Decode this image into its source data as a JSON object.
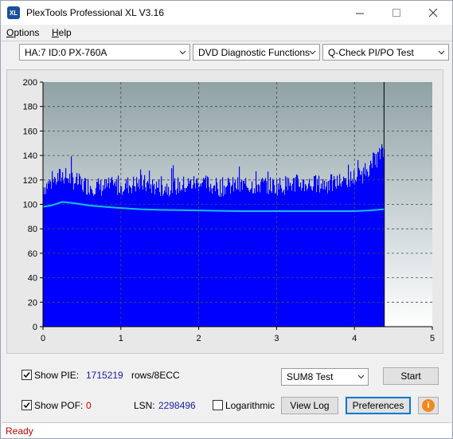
{
  "window": {
    "title": "PlexTools Professional XL V3.16",
    "icon_text": "XL"
  },
  "menu": {
    "items": [
      {
        "label": "Options",
        "accel": "O"
      },
      {
        "label": "Help",
        "accel": "H"
      }
    ]
  },
  "toolbar": {
    "drive": "HA:7 ID:0  PX-760A",
    "function": "DVD Diagnostic Functions",
    "test": "Q-Check PI/PO Test"
  },
  "chart_data": {
    "type": "area",
    "x_ticks": [
      "0",
      "1",
      "2",
      "3",
      "4",
      "5"
    ],
    "y_ticks": [
      "200",
      "180",
      "160",
      "140",
      "120",
      "100",
      "80",
      "60",
      "40",
      "20",
      "0"
    ],
    "xlim": [
      0,
      5
    ],
    "ylim": [
      0,
      200
    ],
    "grid": true,
    "data_end_x": 4.38,
    "series": [
      {
        "type": "bar",
        "color": "#0000ff",
        "x": [
          0.0,
          0.25,
          0.5,
          0.75,
          1.0,
          1.25,
          1.5,
          1.75,
          2.0,
          2.25,
          2.5,
          2.75,
          3.0,
          3.25,
          3.5,
          3.75,
          4.0,
          4.1,
          4.2,
          4.3,
          4.38
        ],
        "y": [
          120,
          130,
          122,
          120,
          121,
          123,
          120,
          121,
          124,
          120,
          121,
          122,
          121,
          123,
          122,
          123,
          128,
          131,
          138,
          145,
          150
        ]
      },
      {
        "type": "line",
        "color": "#19c0e8",
        "x": [
          0.0,
          0.1,
          0.25,
          0.4,
          0.6,
          0.8,
          1.0,
          1.25,
          1.5,
          2.0,
          2.5,
          3.0,
          3.5,
          3.8,
          4.0,
          4.2,
          4.38
        ],
        "y": [
          98,
          99,
          102,
          101,
          99,
          98,
          97,
          96,
          95.5,
          95,
          94.5,
          94.5,
          94.5,
          94.5,
          94.5,
          95,
          96
        ]
      }
    ]
  },
  "panel": {
    "show_pie_label": "Show PIE:",
    "pie_value": "1715219",
    "pie_unit": "rows/8ECC",
    "show_pof_label": "Show POF:",
    "pof_value": "0",
    "lsn_label": "LSN:",
    "lsn_value": "2298496",
    "logarithmic_label": "Logarithmic",
    "test_select": "SUM8 Test",
    "start_label": "Start",
    "view_log_label": "View Log",
    "preferences_label": "Preferences",
    "info_icon_text": "i"
  },
  "status": {
    "text": "Ready"
  }
}
